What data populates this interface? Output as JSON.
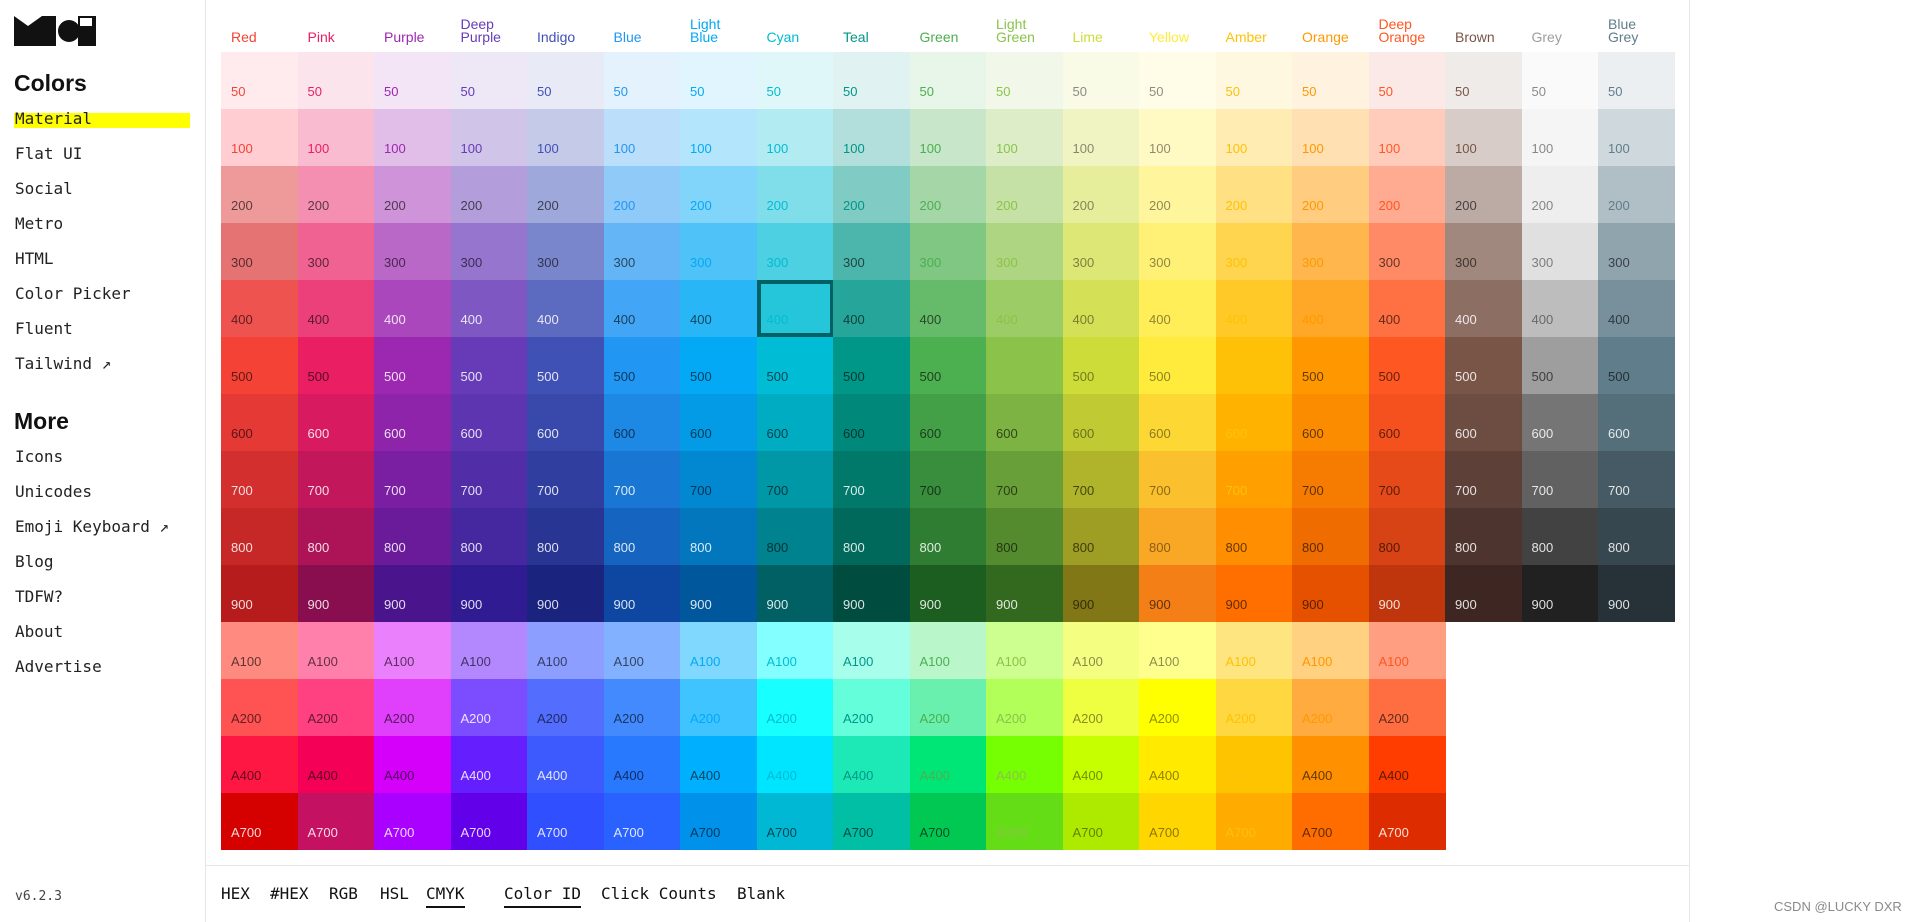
{
  "sidebar": {
    "colors_heading": "Colors",
    "colors_items": [
      {
        "label": "Material",
        "active": true
      },
      {
        "label": "Flat UI",
        "active": false
      },
      {
        "label": "Social",
        "active": false
      },
      {
        "label": "Metro",
        "active": false
      },
      {
        "label": "HTML",
        "active": false
      },
      {
        "label": "Color Picker",
        "active": false
      },
      {
        "label": "Fluent",
        "active": false
      },
      {
        "label": "Tailwind ↗",
        "active": false
      }
    ],
    "more_heading": "More",
    "more_items": [
      {
        "label": "Icons"
      },
      {
        "label": "Unicodes"
      },
      {
        "label": "Emoji Keyboard ↗"
      },
      {
        "label": "Blog"
      },
      {
        "label": "TDFW?"
      },
      {
        "label": "About"
      },
      {
        "label": "Advertise"
      }
    ],
    "version": "v6.2.3"
  },
  "palette": {
    "selected": {
      "color": "Cyan",
      "shade": "400"
    },
    "colors": [
      {
        "name": "Red",
        "heading_color": "#f44336",
        "shades": {
          "50": "#ffebee",
          "100": "#ffcdd2",
          "200": "#ef9a9a",
          "300": "#e57373",
          "400": "#ef5350",
          "500": "#f44336",
          "600": "#e53935",
          "700": "#d32f2f",
          "800": "#c62828",
          "900": "#b71c1c",
          "A100": "#ff8a80",
          "A200": "#ff5252",
          "A400": "#ff1744",
          "A700": "#d50000"
        }
      },
      {
        "name": "Pink",
        "heading_color": "#e91e63",
        "shades": {
          "50": "#fce4ec",
          "100": "#f8bbd0",
          "200": "#f48fb1",
          "300": "#f06292",
          "400": "#ec407a",
          "500": "#e91e63",
          "600": "#d81b60",
          "700": "#c2185b",
          "800": "#ad1457",
          "900": "#880e4f",
          "A100": "#ff80ab",
          "A200": "#ff4081",
          "A400": "#f50057",
          "A700": "#c51162"
        }
      },
      {
        "name": "Purple",
        "heading_color": "#9c27b0",
        "shades": {
          "50": "#f3e5f5",
          "100": "#e1bee7",
          "200": "#ce93d8",
          "300": "#ba68c8",
          "400": "#ab47bc",
          "500": "#9c27b0",
          "600": "#8e24aa",
          "700": "#7b1fa2",
          "800": "#6a1b9a",
          "900": "#4a148c",
          "A100": "#ea80fc",
          "A200": "#e040fb",
          "A400": "#d500f9",
          "A700": "#aa00ff"
        }
      },
      {
        "name": "Deep Purple",
        "heading_color": "#673ab7",
        "shades": {
          "50": "#ede7f6",
          "100": "#d1c4e9",
          "200": "#b39ddb",
          "300": "#9575cd",
          "400": "#7e57c2",
          "500": "#673ab7",
          "600": "#5e35b1",
          "700": "#512da8",
          "800": "#4527a0",
          "900": "#311b92",
          "A100": "#b388ff",
          "A200": "#7c4dff",
          "A400": "#651fff",
          "A700": "#6200ea"
        }
      },
      {
        "name": "Indigo",
        "heading_color": "#3f51b5",
        "shades": {
          "50": "#e8eaf6",
          "100": "#c5cae9",
          "200": "#9fa8da",
          "300": "#7986cb",
          "400": "#5c6bc0",
          "500": "#3f51b5",
          "600": "#3949ab",
          "700": "#303f9f",
          "800": "#283593",
          "900": "#1a237e",
          "A100": "#8c9eff",
          "A200": "#536dfe",
          "A400": "#3d5afe",
          "A700": "#304ffe"
        }
      },
      {
        "name": "Blue",
        "heading_color": "#2196f3",
        "shades": {
          "50": "#e3f2fd",
          "100": "#bbdefb",
          "200": "#90caf9",
          "300": "#64b5f6",
          "400": "#42a5f5",
          "500": "#2196f3",
          "600": "#1e88e5",
          "700": "#1976d2",
          "800": "#1565c0",
          "900": "#0d47a1",
          "A100": "#82b1ff",
          "A200": "#448aff",
          "A400": "#2979ff",
          "A700": "#2962ff"
        }
      },
      {
        "name": "Light Blue",
        "heading_color": "#03a9f4",
        "shades": {
          "50": "#e1f5fe",
          "100": "#b3e5fc",
          "200": "#81d4fa",
          "300": "#4fc3f7",
          "400": "#29b6f6",
          "500": "#03a9f4",
          "600": "#039be5",
          "700": "#0288d1",
          "800": "#0277bd",
          "900": "#01579b",
          "A100": "#80d8ff",
          "A200": "#40c4ff",
          "A400": "#00b0ff",
          "A700": "#0091ea"
        }
      },
      {
        "name": "Cyan",
        "heading_color": "#00bcd4",
        "shades": {
          "50": "#e0f7fa",
          "100": "#b2ebf2",
          "200": "#80deea",
          "300": "#4dd0e1",
          "400": "#26c6da",
          "500": "#00bcd4",
          "600": "#00acc1",
          "700": "#0097a7",
          "800": "#00838f",
          "900": "#006064",
          "A100": "#84ffff",
          "A200": "#18ffff",
          "A400": "#00e5ff",
          "A700": "#00b8d4"
        }
      },
      {
        "name": "Teal",
        "heading_color": "#009688",
        "shades": {
          "50": "#e0f2f1",
          "100": "#b2dfdb",
          "200": "#80cbc4",
          "300": "#4db6ac",
          "400": "#26a69a",
          "500": "#009688",
          "600": "#00897b",
          "700": "#00796b",
          "800": "#00695c",
          "900": "#004d40",
          "A100": "#a7ffeb",
          "A200": "#64ffda",
          "A400": "#1de9b6",
          "A700": "#00bfa5"
        }
      },
      {
        "name": "Green",
        "heading_color": "#4caf50",
        "shades": {
          "50": "#e8f5e9",
          "100": "#c8e6c9",
          "200": "#a5d6a7",
          "300": "#81c784",
          "400": "#66bb6a",
          "500": "#4caf50",
          "600": "#43a047",
          "700": "#388e3c",
          "800": "#2e7d32",
          "900": "#1b5e20",
          "A100": "#b9f6ca",
          "A200": "#69f0ae",
          "A400": "#00e676",
          "A700": "#00c853"
        }
      },
      {
        "name": "Light Green",
        "heading_color": "#8bc34a",
        "shades": {
          "50": "#f1f8e9",
          "100": "#dcedc8",
          "200": "#c5e1a5",
          "300": "#aed581",
          "400": "#9ccc65",
          "500": "#8bc34a",
          "600": "#7cb342",
          "700": "#689f38",
          "800": "#558b2f",
          "900": "#33691e",
          "A100": "#ccff90",
          "A200": "#b2ff59",
          "A400": "#76ff03",
          "A700": "#64dd17"
        }
      },
      {
        "name": "Lime",
        "heading_color": "#cddc39",
        "shades": {
          "50": "#f9fbe7",
          "100": "#f0f4c3",
          "200": "#e6ee9c",
          "300": "#dce775",
          "400": "#d4e157",
          "500": "#cddc39",
          "600": "#c0ca33",
          "700": "#afb42b",
          "800": "#9e9d24",
          "900": "#827717",
          "A100": "#f4ff81",
          "A200": "#eeff41",
          "A400": "#c6ff00",
          "A700": "#aeea00"
        }
      },
      {
        "name": "Yellow",
        "heading_color": "#ffeb3b",
        "shades": {
          "50": "#fffde7",
          "100": "#fff9c4",
          "200": "#fff59d",
          "300": "#fff176",
          "400": "#ffee58",
          "500": "#ffeb3b",
          "600": "#fdd835",
          "700": "#fbc02d",
          "800": "#f9a825",
          "900": "#f57f17",
          "A100": "#ffff8d",
          "A200": "#ffff00",
          "A400": "#ffea00",
          "A700": "#ffd600"
        }
      },
      {
        "name": "Amber",
        "heading_color": "#ffc107",
        "shades": {
          "50": "#fff8e1",
          "100": "#ffecb3",
          "200": "#ffe082",
          "300": "#ffd54f",
          "400": "#ffca28",
          "500": "#ffc107",
          "600": "#ffb300",
          "700": "#ffa000",
          "800": "#ff8f00",
          "900": "#ff6f00",
          "A100": "#ffe57f",
          "A200": "#ffd740",
          "A400": "#ffc400",
          "A700": "#ffab00"
        }
      },
      {
        "name": "Orange",
        "heading_color": "#ff9800",
        "shades": {
          "50": "#fff3e0",
          "100": "#ffe0b2",
          "200": "#ffcc80",
          "300": "#ffb74d",
          "400": "#ffa726",
          "500": "#ff9800",
          "600": "#fb8c00",
          "700": "#f57c00",
          "800": "#ef6c00",
          "900": "#e65100",
          "A100": "#ffd180",
          "A200": "#ffab40",
          "A400": "#ff9100",
          "A700": "#ff6d00"
        }
      },
      {
        "name": "Deep Orange",
        "heading_color": "#ff5722",
        "shades": {
          "50": "#fbe9e7",
          "100": "#ffccbc",
          "200": "#ffab91",
          "300": "#ff8a65",
          "400": "#ff7043",
          "500": "#ff5722",
          "600": "#f4511e",
          "700": "#e64a19",
          "800": "#d84315",
          "900": "#bf360c",
          "A100": "#ff9e80",
          "A200": "#ff6e40",
          "A400": "#ff3d00",
          "A700": "#dd2c00"
        }
      },
      {
        "name": "Brown",
        "heading_color": "#795548",
        "shades": {
          "50": "#efebe9",
          "100": "#d7ccc8",
          "200": "#bcaaa4",
          "300": "#a1887f",
          "400": "#8d6e63",
          "500": "#795548",
          "600": "#6d4c41",
          "700": "#5d4037",
          "800": "#4e342e",
          "900": "#3e2723"
        }
      },
      {
        "name": "Grey",
        "heading_color": "#9e9e9e",
        "shades": {
          "50": "#fafafa",
          "100": "#f5f5f5",
          "200": "#eeeeee",
          "300": "#e0e0e0",
          "400": "#bdbdbd",
          "500": "#9e9e9e",
          "600": "#757575",
          "700": "#616161",
          "800": "#424242",
          "900": "#212121"
        }
      },
      {
        "name": "Blue Grey",
        "heading_color": "#607d8b",
        "shades": {
          "50": "#eceff1",
          "100": "#cfd8dc",
          "200": "#b0bec5",
          "300": "#90a4ae",
          "400": "#78909c",
          "500": "#607d8b",
          "600": "#546e7a",
          "700": "#455a64",
          "800": "#37474f",
          "900": "#263238"
        }
      }
    ]
  },
  "bottom_bar": {
    "format_options": [
      {
        "label": "HEX",
        "active": false
      },
      {
        "label": "#HEX",
        "active": false
      },
      {
        "label": "RGB",
        "active": false
      },
      {
        "label": "HSL",
        "active": false
      },
      {
        "label": "CMYK",
        "active": true
      }
    ],
    "display_options": [
      {
        "label": "Color ID",
        "active": true
      },
      {
        "label": "Click Counts",
        "active": false
      },
      {
        "label": "Blank",
        "active": false
      }
    ]
  },
  "watermark": "CSDN @LUCKY DXR"
}
